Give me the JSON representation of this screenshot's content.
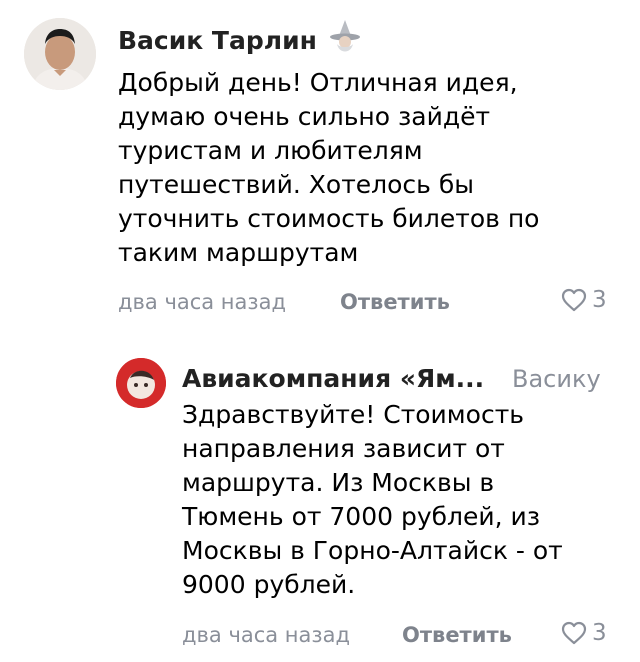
{
  "comments": [
    {
      "author": "Васик Тарлин",
      "text": "Добрый день! Отличная идея,\nдумаю очень сильно зайдёт\nтуристам и любителям\nпутешествий. Хотелось бы\nуточнить стоимость билетов по\nтаким маршрутам",
      "time": "два часа назад",
      "reply_label": "Ответить",
      "likes": "3"
    },
    {
      "author": "Авиакомпания «Ям...",
      "reply_to": "Васику",
      "text": "Здравствуйте! Стоимость\nнаправления зависит от\nмаршрута. Из Москвы в\nТюмень от 7000 рублей, из\nМосквы в Горно-Алтайск - от\n9000 рублей.",
      "time": "два часа назад",
      "reply_label": "Ответить",
      "likes": "3"
    }
  ],
  "colors": {
    "muted": "#8a8f99",
    "accent_red": "#d42a2a"
  }
}
